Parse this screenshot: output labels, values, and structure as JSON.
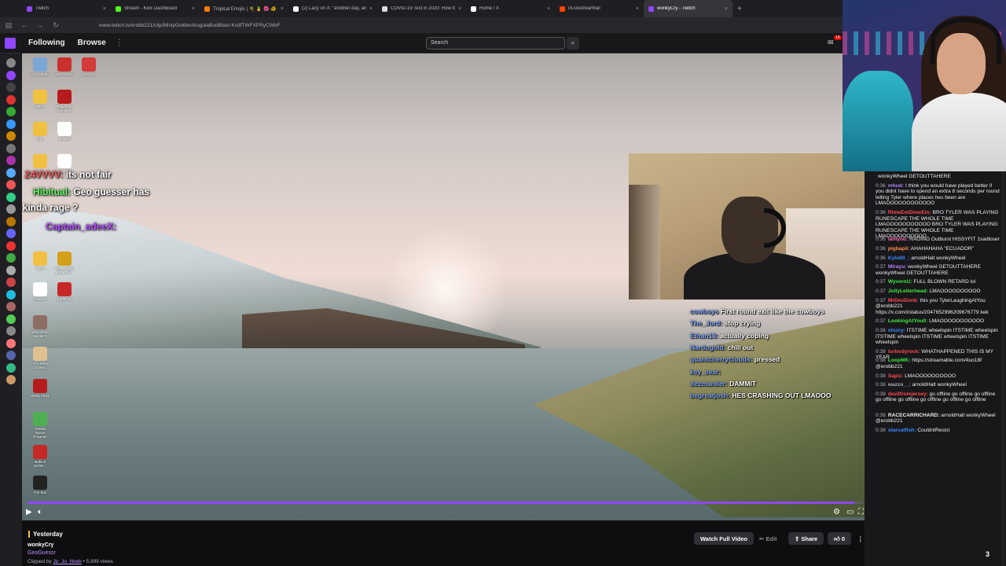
{
  "browser": {
    "tabs": [
      {
        "label": "Twitch",
        "color": "#9147ff"
      },
      {
        "label": "Stream - Kick Dashboard",
        "color": "#53fc18"
      },
      {
        "label": "Tropical Emojis | 🌴 🍍 🌺 🐠",
        "color": "#ff7a00"
      },
      {
        "label": "(2) Lacy on X: \"another day, an",
        "color": "#ffffff"
      },
      {
        "label": "COVID-19 Test in 2020: How It",
        "color": "#dddddd"
      },
      {
        "label": "Home / X",
        "color": "#ffffff"
      },
      {
        "label": "r/Livestreamfail",
        "color": "#ff4500"
      },
      {
        "label": "wonkyCry - Twitch",
        "color": "#9147ff"
      }
    ],
    "active_tab_index": 7,
    "url": "www.twitch.tv/erobb221/clip/MistyGoldenArugulaBudBlast-KcdfTWFXPRyCWbF"
  },
  "header": {
    "nav": [
      "Following",
      "Browse"
    ],
    "search_placeholder": "Search",
    "notif_count": "14"
  },
  "overlay_left": [
    {
      "user": "Z4VVVV:",
      "text": "its not fair"
    },
    {
      "user": "Hibitual:",
      "text": "Geo guesser has"
    },
    {
      "user": "",
      "text": "this kinda rage ?"
    },
    {
      "user": "Captain_adeeX:",
      "text": ""
    }
  ],
  "overlay_right": [
    {
      "user": "cowboys",
      "text": "First round exit like the cowboys"
    },
    {
      "user": "The_Jord:",
      "text": "stop crying"
    },
    {
      "user": "Ethan13:",
      "text": "actually coping"
    },
    {
      "user": "Nardogold:",
      "text": "chill out"
    },
    {
      "user": "quantcherryclouds:",
      "text": "pressed"
    },
    {
      "user": "key_sear:",
      "text": ""
    },
    {
      "user": "dezmander:",
      "text": "DAMMIT"
    },
    {
      "user": "begreatjosh:",
      "text": "HES CRASHING OUT LMAOOO"
    }
  ],
  "desktop_icons": [
    {
      "label": "Recycle Bin",
      "color": "#7aa7d6"
    },
    {
      "label": "Red Reticle",
      "color": "#c9302c"
    },
    {
      "label": "re-Dead",
      "color": "#d43b3b"
    },
    {
      "label": "Steam",
      "color": "#f0c040"
    },
    {
      "label": "Plague Inc Evolved",
      "color": "#b71c1c"
    },
    {
      "label": "clips",
      "color": "#f0c040"
    },
    {
      "label": "untitled",
      "color": "#ffffff"
    },
    {
      "label": "folder",
      "color": "#f0c040"
    },
    {
      "label": "desktop.ini",
      "color": "#ffffff"
    },
    {
      "label": "Twitch",
      "color": "#f0c040"
    },
    {
      "label": "Poker Night at the Inv...",
      "color": "#d4a017"
    },
    {
      "label": "Discord",
      "color": "#ffffff"
    },
    {
      "label": "Cartel Inc",
      "color": "#c62828"
    },
    {
      "label": "Way of the Hunter 2",
      "color": "#8d6e63"
    },
    {
      "label": "I Am Jesus Christ",
      "color": "#e0c090"
    },
    {
      "label": "WWE 2K24",
      "color": "#b71c1c"
    },
    {
      "label": "Kerbal Space Program",
      "color": "#4caf50"
    },
    {
      "label": "Mafia II Definit...",
      "color": "#c62828"
    },
    {
      "label": "The Bus",
      "color": "#222222"
    }
  ],
  "player": {
    "progress_fraction": 0.99
  },
  "info": {
    "date_label": "Yesterday",
    "channel": "wonkyCry",
    "game": "GeoGuessr",
    "clipped_by_prefix": "Clipped by",
    "clipper": "Jo_Jo_Nveb",
    "views": "• 5,999 views",
    "watch_full": "Watch Full Video",
    "edit": "Edit",
    "share": "Share",
    "likes": "0"
  },
  "chat": [
    {
      "ts": "",
      "user": "",
      "text": "wonkyWheel GETOUTTAHERE",
      "color": "#efeff1"
    },
    {
      "ts": "0:36",
      "user": "mhud:",
      "text": "I think you would have played better if you didnt have to spend an extra 8 seconds per round telling Tyler where places hes been are LMAOOOOOOOOOOOO",
      "color": "#b580ff"
    },
    {
      "ts": "0:36",
      "user": "RimeEmDimeEm:",
      "text": "BRO TYLER WAS PLAYING RUNESCAPE THE WHOLE TIME LMAOOOOOOOOOOO BRO TYLER WAS PLAYING RUNESCAPE THE WHOLE TIME LMAOOOOOOOOOO",
      "color": "#ff4a4a"
    },
    {
      "ts": "0:36",
      "user": "lamyoo:",
      "text": "RAGING Outburst HISSYFIT 1sadloser",
      "color": "#ff69b4"
    },
    {
      "ts": "0:36",
      "user": "pigbapii:",
      "text": "AHAHAHAHA \"ECUADOR\"",
      "color": "#ff8c42"
    },
    {
      "ts": "0:36",
      "user": "Kylo00_:",
      "text": "arnoldHalt wonkyWheel",
      "color": "#3a8cff"
    },
    {
      "ts": "0:37",
      "user": "Mirayu:",
      "text": "wonkyWheel GETOUTTAHERE wonkyWheel GETOUTTAHERE",
      "color": "#b580ff"
    },
    {
      "ts": "0:37",
      "user": "WyvernU:",
      "text": "FULL BLOWN RETARD lol",
      "color": "#3ee83e"
    },
    {
      "ts": "0:37",
      "user": "JollyLetterhead:",
      "text": "LMAOOOOOOOOOO",
      "color": "#3ee83e"
    },
    {
      "ts": "0:37",
      "user": "MrDevDonk:",
      "text": "this you TylerLaughingAtYou @erobb221 https://x.com/i/status/2047652996209676779 kek",
      "color": "#ff4a4a"
    },
    {
      "ts": "0:37",
      "user": "LookingAtYou0:",
      "text": "LMAOOOOOOOOOOO",
      "color": "#3ee83e"
    },
    {
      "ts": "0:38",
      "user": "ohuny:",
      "text": "ITSTIME wheelspin ITSTIME wheelspin ITSTIME wheelspin ITSTIME wheelspin ITSTIME wheelspin",
      "color": "#3a8cff"
    },
    {
      "ts": "0:38",
      "user": "turbodyrock:",
      "text": "WHATHAPPENED THIS IS MY YEAR",
      "color": "#ff4a4a"
    },
    {
      "ts": "0:38",
      "user": "LoopMK:",
      "text": "https://streamable.com/4uo18f @erobb221",
      "color": "#3ee83e"
    },
    {
      "ts": "0:38",
      "user": "Sapiz:",
      "text": "LMAOOOOOOOOOO",
      "color": "#ff4a4a"
    },
    {
      "ts": "0:38",
      "user": "wazzo__:",
      "text": "arnoldHalt wonkyWheel",
      "color": "#adadb8"
    },
    {
      "ts": "0:38",
      "user": "devilfromjersey:",
      "text": "go offline go offline go offline go offline go offline go offline go offline go offline",
      "color": "#ff4a4a"
    },
    {
      "ts": "0:38",
      "user": "RACECARRICHARD:",
      "text": "arnoldHalt wonkyWheel @erobb221",
      "color": "#efeff1"
    },
    {
      "ts": "0:38",
      "user": "starcatfish:",
      "text": "CouldntResist",
      "color": "#3a8cff"
    }
  ],
  "chat_corner_count": "3"
}
